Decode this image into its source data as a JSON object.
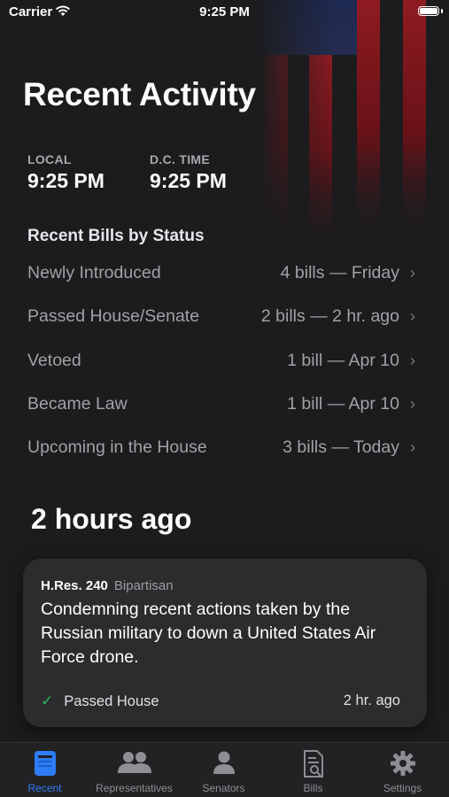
{
  "status_bar": {
    "carrier": "Carrier",
    "time": "9:25 PM"
  },
  "header": {
    "title": "Recent Activity"
  },
  "clocks": [
    {
      "label": "LOCAL",
      "value": "9:25 PM"
    },
    {
      "label": "D.C. TIME",
      "value": "9:25 PM"
    }
  ],
  "bills_by_status": {
    "heading": "Recent Bills by Status",
    "rows": [
      {
        "label": "Newly Introduced",
        "value": "4 bills — Friday"
      },
      {
        "label": "Passed House/Senate",
        "value": "2 bills — 2 hr. ago"
      },
      {
        "label": "Vetoed",
        "value": "1 bill — Apr 10"
      },
      {
        "label": "Became Law",
        "value": "1 bill — Apr 10"
      },
      {
        "label": "Upcoming in the House",
        "value": "3 bills — Today"
      }
    ]
  },
  "activity": {
    "time_heading": "2 hours ago",
    "card": {
      "bill_number": "H.Res. 240",
      "tag": "Bipartisan",
      "description": "Condemning recent actions taken by the Russian military to down a United States Air Force drone.",
      "status": "Passed House",
      "ago": "2 hr. ago"
    }
  },
  "tabs": [
    {
      "label": "Recent",
      "icon": "newspaper-icon",
      "active": true
    },
    {
      "label": "Representatives",
      "icon": "people-icon",
      "active": false
    },
    {
      "label": "Senators",
      "icon": "person-icon",
      "active": false
    },
    {
      "label": "Bills",
      "icon": "document-search-icon",
      "active": false
    },
    {
      "label": "Settings",
      "icon": "gear-icon",
      "active": false
    }
  ],
  "colors": {
    "accent": "#2e7cf6",
    "success": "#2fb45a",
    "background": "#1c1c1e",
    "card": "#2c2c2e"
  }
}
